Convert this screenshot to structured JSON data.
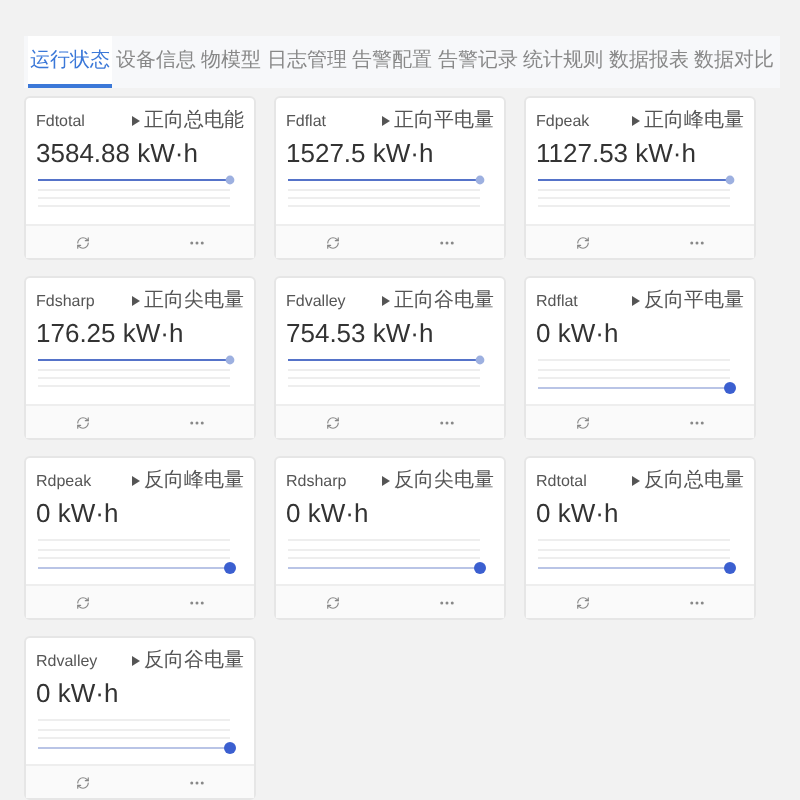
{
  "tabs": [
    {
      "label": "运行状态",
      "selected": true
    },
    {
      "label": "设备信息",
      "selected": false
    },
    {
      "label": "物模型",
      "selected": false
    },
    {
      "label": "日志管理",
      "selected": false
    },
    {
      "label": "告警配置",
      "selected": false
    },
    {
      "label": "告警记录",
      "selected": false
    },
    {
      "label": "统计规则",
      "selected": false
    },
    {
      "label": "数据报表",
      "selected": false
    },
    {
      "label": "数据对比",
      "selected": false
    }
  ],
  "cards": [
    {
      "name": "Fdtotal",
      "label": "正向总电能",
      "value": "3584.88 kW·h",
      "kind": "high"
    },
    {
      "name": "Fdflat",
      "label": "正向平电量",
      "value": "1527.5 kW·h",
      "kind": "high"
    },
    {
      "name": "Fdpeak",
      "label": "正向峰电量",
      "value": "1127.53 kW·h",
      "kind": "high"
    },
    {
      "name": "Fdsharp",
      "label": "正向尖电量",
      "value": "176.25 kW·h",
      "kind": "high"
    },
    {
      "name": "Fdvalley",
      "label": "正向谷电量",
      "value": "754.53 kW·h",
      "kind": "high"
    },
    {
      "name": "Rdflat",
      "label": "反向平电量",
      "value": "0 kW·h",
      "kind": "zero"
    },
    {
      "name": "Rdpeak",
      "label": "反向峰电量",
      "value": "0 kW·h",
      "kind": "zero"
    },
    {
      "name": "Rdsharp",
      "label": "反向尖电量",
      "value": "0 kW·h",
      "kind": "zero"
    },
    {
      "name": "Rdtotal",
      "label": "反向总电量",
      "value": "0 kW·h",
      "kind": "zero"
    },
    {
      "name": "Rdvalley",
      "label": "反向谷电量",
      "value": "0 kW·h",
      "kind": "zero"
    }
  ]
}
